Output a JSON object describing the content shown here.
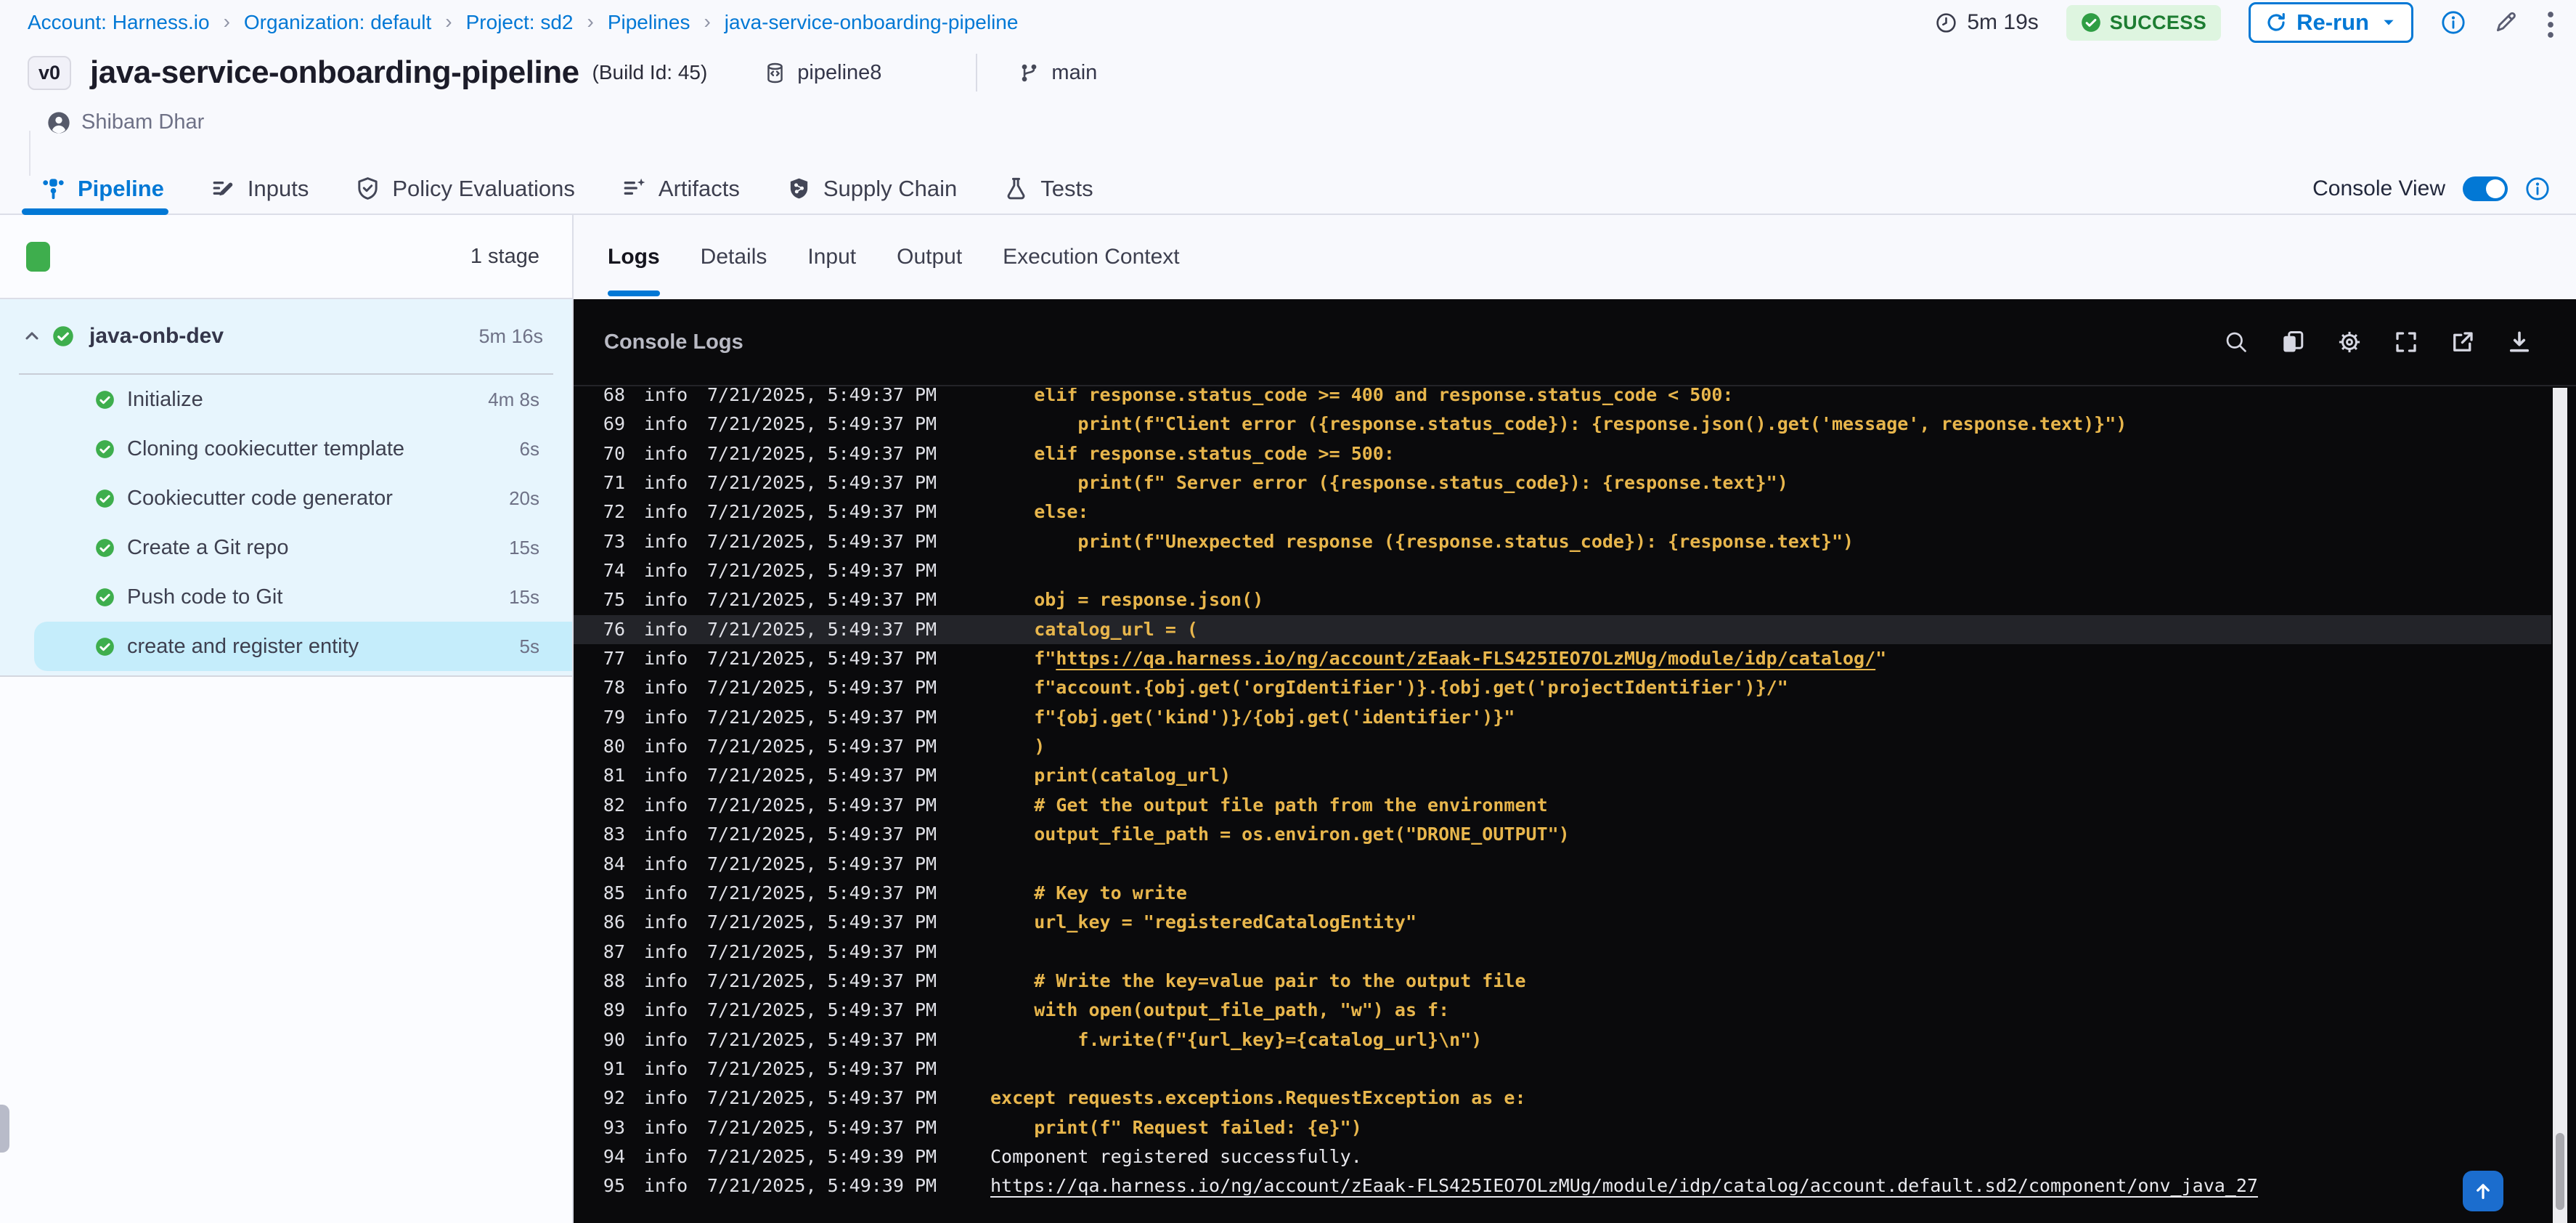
{
  "breadcrumb": {
    "items": [
      "Account: Harness.io",
      "Organization: default",
      "Project: sd2",
      "Pipelines",
      "java-service-onboarding-pipeline"
    ]
  },
  "topbar": {
    "duration": "5m 19s",
    "status": "SUCCESS",
    "rerun_label": "Re-run",
    "icons": [
      "clock-icon",
      "check-circle-icon",
      "refresh-icon",
      "caret-down-icon",
      "info-icon",
      "pencil-icon",
      "kebab-menu-icon"
    ]
  },
  "header": {
    "version_badge": "v0",
    "title": "java-service-onboarding-pipeline",
    "build_id": "(Build Id: 45)",
    "pipeline_name": "pipeline8",
    "branch": "main",
    "author": "Shibam Dhar"
  },
  "tabs": {
    "items": [
      {
        "label": "Pipeline",
        "active": true
      },
      {
        "label": "Inputs",
        "active": false
      },
      {
        "label": "Policy Evaluations",
        "active": false
      },
      {
        "label": "Artifacts",
        "active": false
      },
      {
        "label": "Supply Chain",
        "active": false
      },
      {
        "label": "Tests",
        "active": false
      }
    ],
    "console_view_label": "Console View",
    "console_view_on": true
  },
  "sidebar": {
    "stage_count": "1 stage",
    "stage": {
      "name": "java-onb-dev",
      "duration": "5m 16s",
      "status": "success"
    },
    "steps": [
      {
        "name": "Initialize",
        "duration": "4m 8s",
        "status": "success"
      },
      {
        "name": "Cloning cookiecutter template",
        "duration": "6s",
        "status": "success"
      },
      {
        "name": "Cookiecutter code generator",
        "duration": "20s",
        "status": "success"
      },
      {
        "name": "Create a Git repo",
        "duration": "15s",
        "status": "success"
      },
      {
        "name": "Push code to Git",
        "duration": "15s",
        "status": "success"
      },
      {
        "name": "create and register entity",
        "duration": "5s",
        "status": "success",
        "selected": true
      }
    ]
  },
  "panel": {
    "tabs": [
      {
        "label": "Logs",
        "active": true
      },
      {
        "label": "Details",
        "active": false
      },
      {
        "label": "Input",
        "active": false
      },
      {
        "label": "Output",
        "active": false
      },
      {
        "label": "Execution Context",
        "active": false
      }
    ]
  },
  "console": {
    "title": "Console Logs",
    "toolbar_icons": [
      "search-icon",
      "copy-icon",
      "gear-icon",
      "fullscreen-icon",
      "open-in-new-icon",
      "download-icon",
      "scroll-to-top-icon"
    ],
    "lines": [
      {
        "n": "68",
        "lvl": "info",
        "ts": "7/21/2025, 5:49:37 PM",
        "seg": [
          {
            "t": "    elif response.status_code >= 400 and response.status_code < 500:"
          }
        ]
      },
      {
        "n": "69",
        "lvl": "info",
        "ts": "7/21/2025, 5:49:37 PM",
        "seg": [
          {
            "t": "        print(f\"Client error ({response.status_code}): {response.json().get('message', response.text)}\")"
          }
        ]
      },
      {
        "n": "70",
        "lvl": "info",
        "ts": "7/21/2025, 5:49:37 PM",
        "seg": [
          {
            "t": "    elif response.status_code >= 500:"
          }
        ]
      },
      {
        "n": "71",
        "lvl": "info",
        "ts": "7/21/2025, 5:49:37 PM",
        "seg": [
          {
            "t": "        print(f\" Server error ({response.status_code}): {response.text}\")"
          }
        ]
      },
      {
        "n": "72",
        "lvl": "info",
        "ts": "7/21/2025, 5:49:37 PM",
        "seg": [
          {
            "t": "    else:"
          }
        ]
      },
      {
        "n": "73",
        "lvl": "info",
        "ts": "7/21/2025, 5:49:37 PM",
        "seg": [
          {
            "t": "        print(f\"Unexpected response ({response.status_code}): {response.text}\")"
          }
        ]
      },
      {
        "n": "74",
        "lvl": "info",
        "ts": "7/21/2025, 5:49:37 PM",
        "seg": []
      },
      {
        "n": "75",
        "lvl": "info",
        "ts": "7/21/2025, 5:49:37 PM",
        "seg": [
          {
            "t": "    obj = response.json()"
          }
        ]
      },
      {
        "n": "76",
        "lvl": "info",
        "ts": "7/21/2025, 5:49:37 PM",
        "hl": true,
        "seg": [
          {
            "t": "    catalog_url = ("
          }
        ]
      },
      {
        "n": "77",
        "lvl": "info",
        "ts": "7/21/2025, 5:49:37 PM",
        "seg": [
          {
            "t": "    f\""
          },
          {
            "t": "https://qa.harness.io/ng/account/zEaak-FLS425IEO7OLzMUg/module/idp/catalog/",
            "u": 1
          },
          {
            "t": "\""
          }
        ]
      },
      {
        "n": "78",
        "lvl": "info",
        "ts": "7/21/2025, 5:49:37 PM",
        "seg": [
          {
            "t": "    f\"account.{obj.get('orgIdentifier')}.{obj.get('projectIdentifier')}/\""
          }
        ]
      },
      {
        "n": "79",
        "lvl": "info",
        "ts": "7/21/2025, 5:49:37 PM",
        "seg": [
          {
            "t": "    f\"{obj.get('kind')}/{obj.get('identifier')}\""
          }
        ]
      },
      {
        "n": "80",
        "lvl": "info",
        "ts": "7/21/2025, 5:49:37 PM",
        "seg": [
          {
            "t": "    )"
          }
        ]
      },
      {
        "n": "81",
        "lvl": "info",
        "ts": "7/21/2025, 5:49:37 PM",
        "seg": [
          {
            "t": "    print(catalog_url)"
          }
        ]
      },
      {
        "n": "82",
        "lvl": "info",
        "ts": "7/21/2025, 5:49:37 PM",
        "seg": [
          {
            "t": "    # Get the output file path from the environment"
          }
        ]
      },
      {
        "n": "83",
        "lvl": "info",
        "ts": "7/21/2025, 5:49:37 PM",
        "seg": [
          {
            "t": "    output_file_path = os.environ.get(\"DRONE_OUTPUT\")"
          }
        ]
      },
      {
        "n": "84",
        "lvl": "info",
        "ts": "7/21/2025, 5:49:37 PM",
        "seg": []
      },
      {
        "n": "85",
        "lvl": "info",
        "ts": "7/21/2025, 5:49:37 PM",
        "seg": [
          {
            "t": "    # Key to write"
          }
        ]
      },
      {
        "n": "86",
        "lvl": "info",
        "ts": "7/21/2025, 5:49:37 PM",
        "seg": [
          {
            "t": "    url_key = \"registeredCatalogEntity\""
          }
        ]
      },
      {
        "n": "87",
        "lvl": "info",
        "ts": "7/21/2025, 5:49:37 PM",
        "seg": []
      },
      {
        "n": "88",
        "lvl": "info",
        "ts": "7/21/2025, 5:49:37 PM",
        "seg": [
          {
            "t": "    # Write the key=value pair to the output file"
          }
        ]
      },
      {
        "n": "89",
        "lvl": "info",
        "ts": "7/21/2025, 5:49:37 PM",
        "seg": [
          {
            "t": "    with open(output_file_path, \"w\") as f:"
          }
        ]
      },
      {
        "n": "90",
        "lvl": "info",
        "ts": "7/21/2025, 5:49:37 PM",
        "seg": [
          {
            "t": "        f.write(f\"{url_key}={catalog_url}\\n\")"
          }
        ]
      },
      {
        "n": "91",
        "lvl": "info",
        "ts": "7/21/2025, 5:49:37 PM",
        "seg": []
      },
      {
        "n": "92",
        "lvl": "info",
        "ts": "7/21/2025, 5:49:37 PM",
        "seg": [
          {
            "t": "except requests.exceptions.RequestException as e:"
          }
        ]
      },
      {
        "n": "93",
        "lvl": "info",
        "ts": "7/21/2025, 5:49:37 PM",
        "seg": [
          {
            "t": "    print(f\" Request failed: {e}\")"
          }
        ]
      },
      {
        "n": "94",
        "lvl": "info",
        "ts": "7/21/2025, 5:49:39 PM",
        "seg": [
          {
            "t": "Component registered successfully.",
            "w": 1
          }
        ]
      },
      {
        "n": "95",
        "lvl": "info",
        "ts": "7/21/2025, 5:49:39 PM",
        "seg": [
          {
            "t": "https://qa.harness.io/ng/account/zEaak-FLS425IEO7OLzMUg/module/idp/catalog/account.default.sd2/component/onv_java_27",
            "w": 1,
            "u": 1
          }
        ]
      }
    ]
  },
  "colors": {
    "accent_blue": "#0278d5",
    "success_green": "#3eae4d",
    "badge_bg": "#def5e0",
    "badge_text": "#1d7d32",
    "sidebar_blue": "#e7f5fd",
    "selected_step_bg": "#c5edfb",
    "console_bg": "#0a0a0c",
    "log_yellow": "#e8b64c",
    "log_white": "#e9e9ee",
    "highlight_row": "#232429"
  }
}
